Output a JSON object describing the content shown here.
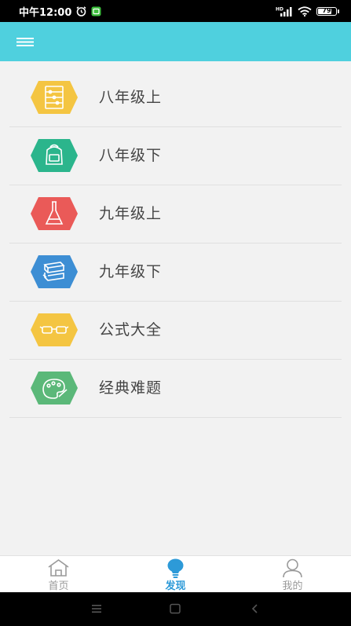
{
  "status": {
    "time": "中午12:00",
    "battery": "79",
    "battery_level": 0.79,
    "network_label": "HD"
  },
  "app_bar": {
    "menu_icon": "hamburger-icon"
  },
  "categories": [
    {
      "label": "八年级上",
      "icon": "abacus-icon",
      "color": "#f4c542"
    },
    {
      "label": "八年级下",
      "icon": "backpack-icon",
      "color": "#2bb58c"
    },
    {
      "label": "九年级上",
      "icon": "flask-icon",
      "color": "#ea5a58"
    },
    {
      "label": "九年级下",
      "icon": "books-icon",
      "color": "#3d8ed4"
    },
    {
      "label": "公式大全",
      "icon": "glasses-icon",
      "color": "#f4c542"
    },
    {
      "label": "经典难题",
      "icon": "palette-icon",
      "color": "#5bb879"
    }
  ],
  "bottom_nav": {
    "active_color": "#2d9ad8",
    "tabs": [
      {
        "label": "首页",
        "icon": "home-icon",
        "active": false
      },
      {
        "label": "发现",
        "icon": "lightbulb-icon",
        "active": true
      },
      {
        "label": "我的",
        "icon": "person-icon",
        "active": false
      }
    ]
  },
  "system_nav": {
    "icons": [
      "menu-icon",
      "home-square-icon",
      "back-icon"
    ]
  }
}
